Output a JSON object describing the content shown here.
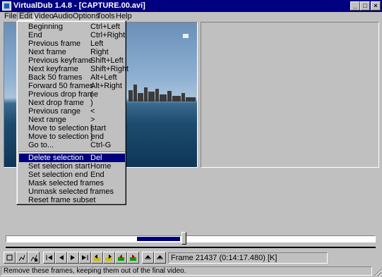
{
  "window": {
    "title": "VirtualDub 1.4.8 - [CAPTURE.00.avi]",
    "minimize_glyph": "_",
    "maximize_glyph": "□",
    "close_glyph": "×"
  },
  "menubar": {
    "items": [
      "File",
      "Edit",
      "Video",
      "Audio",
      "Options",
      "Tools",
      "Help"
    ],
    "active": "Edit"
  },
  "edit_menu": {
    "group1": [
      {
        "label": "Beginning",
        "shortcut": "Ctrl+Left"
      },
      {
        "label": "End",
        "shortcut": "Ctrl+Right"
      },
      {
        "label": "Previous frame",
        "shortcut": "Left"
      },
      {
        "label": "Next frame",
        "shortcut": "Right"
      },
      {
        "label": "Previous keyframe",
        "shortcut": "Shift+Left"
      },
      {
        "label": "Next keyframe",
        "shortcut": "Shift+Right"
      },
      {
        "label": "Back 50 frames",
        "shortcut": "Alt+Left"
      },
      {
        "label": "Forward 50 frames",
        "shortcut": "Alt+Right"
      },
      {
        "label": "Previous drop frame",
        "shortcut": "("
      },
      {
        "label": "Next drop frame",
        "shortcut": ")"
      },
      {
        "label": "Previous range",
        "shortcut": "<"
      },
      {
        "label": "Next range",
        "shortcut": ">"
      },
      {
        "label": "Move to selection start",
        "shortcut": "["
      },
      {
        "label": "Move to selection end",
        "shortcut": "]"
      },
      {
        "label": "Go to...",
        "shortcut": "Ctrl-G"
      }
    ],
    "group2": [
      {
        "label": "Delete selection",
        "shortcut": "Del",
        "highlighted": true
      },
      {
        "label": "Set selection start",
        "shortcut": "Home"
      },
      {
        "label": "Set selection end",
        "shortcut": "End"
      },
      {
        "label": "Mask selected frames",
        "shortcut": ""
      },
      {
        "label": "Unmask selected frames",
        "shortcut": ""
      },
      {
        "label": "Reset frame subset",
        "shortcut": ""
      }
    ]
  },
  "position": {
    "frame_text": "Frame 21437 (0:14:17.480) [K]",
    "selection_start_fraction": 0.355,
    "selection_end_fraction": 0.472,
    "thumb_fraction": 0.475
  },
  "toolbar": {
    "buttons": [
      "stop-icon",
      "play-input-icon",
      "play-output-icon",
      "start-icon",
      "prev-frame-icon",
      "next-frame-icon",
      "end-icon",
      "prev-keyframe-icon",
      "next-keyframe-icon",
      "scene-back-icon",
      "scene-forward-icon",
      "mark-in-icon",
      "mark-out-icon"
    ]
  },
  "status": {
    "text": "Remove these frames, keeping them out of the final video."
  },
  "colors": {
    "title_bg": "#000080",
    "highlight_bg": "#000080",
    "face": "#c0c0c0"
  }
}
